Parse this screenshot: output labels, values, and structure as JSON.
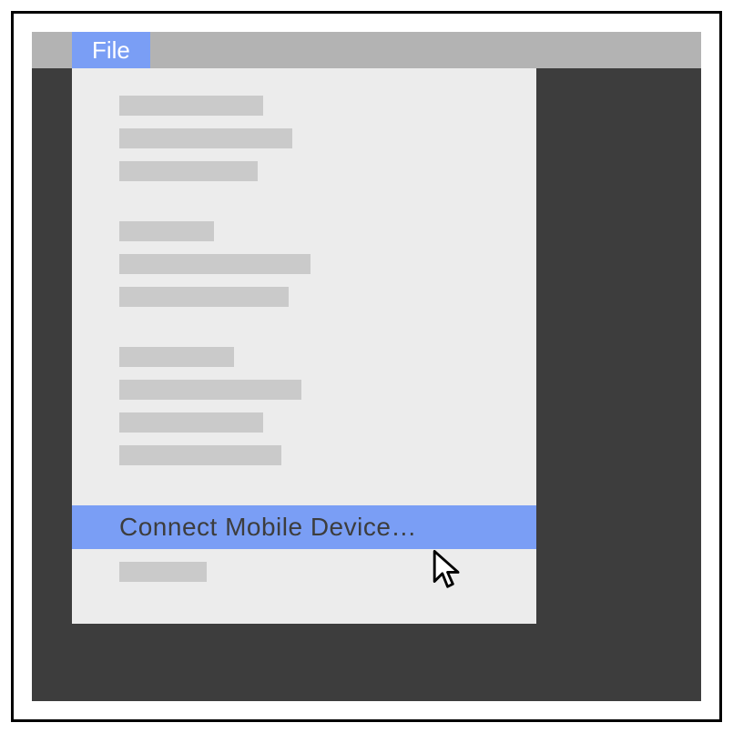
{
  "menubar": {
    "file_label": "File"
  },
  "dropdown": {
    "highlighted_item_label": "Connect Mobile Device…",
    "placeholder_groups": [
      [
        158,
        190,
        152
      ],
      [
        104,
        210,
        186
      ],
      [
        126,
        200,
        158,
        178
      ],
      [
        0
      ],
      [
        96
      ]
    ]
  },
  "colors": {
    "accent": "#7a9ef5",
    "menubar": "#b3b3b3",
    "dropdown_bg": "#ececec",
    "placeholder": "#cacaca",
    "app_bg": "#3d3d3d"
  }
}
